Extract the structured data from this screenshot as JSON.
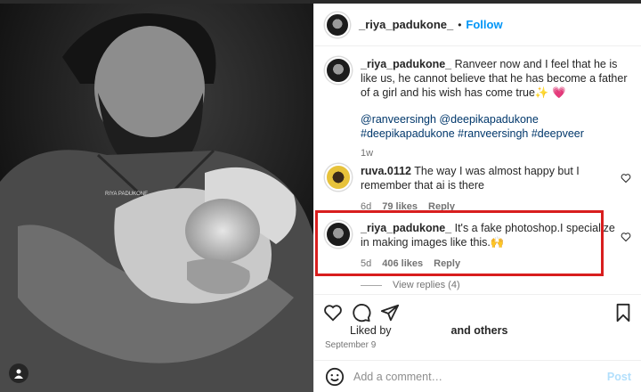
{
  "post": {
    "username": "_riya_padukone_",
    "follow_label": "Follow",
    "separator": "•",
    "caption": {
      "username": "_riya_padukone_",
      "text": " Ranveer now and I feel that he is like us, he cannot believe that he has become a father of a girl and his wish has come true✨ 💗",
      "tags": "@ranveersingh @deepikapadukone #deepikapadukone #ranveersingh #deepveer",
      "time": "1w"
    },
    "comments": [
      {
        "username": "ruva.0112",
        "text": " The way I was almost happy but I remember that ai is there",
        "time": "6d",
        "likes": "79 likes",
        "reply": "Reply"
      },
      {
        "username": "_riya_padukone_",
        "text": " It's a fake photoshop.I specialize in making images like this.🙌",
        "time": "5d",
        "likes": "406 likes",
        "reply": "Reply"
      }
    ],
    "view_replies": "View replies (4)",
    "liked_by_prefix": "Liked by",
    "liked_by_suffix": "and others",
    "date": "September 9",
    "add_comment_placeholder": "Add a comment…",
    "post_label": "Post",
    "photo_watermark": "RIYA PADUKONE"
  },
  "colors": {
    "link": "#0095f6",
    "hashtag": "#00376b",
    "highlight": "#d81e1e"
  }
}
